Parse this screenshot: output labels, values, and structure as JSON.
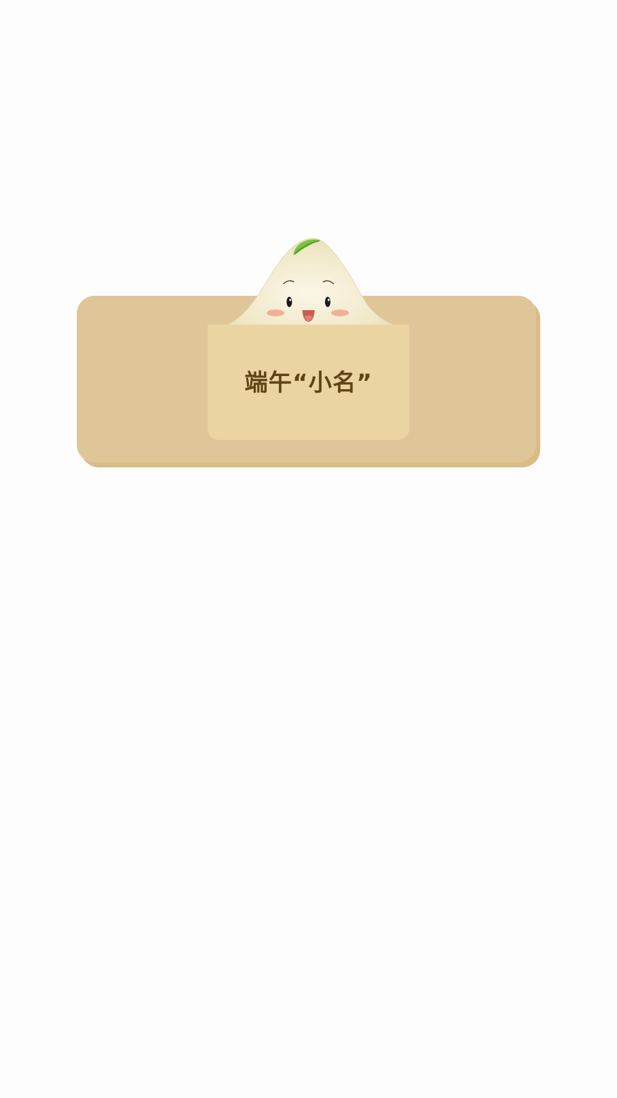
{
  "card": {
    "title": "端午“小名”"
  },
  "mascot": {
    "icon": "zongzi-mascot-icon"
  },
  "colors": {
    "page_background": "#fdfdfd",
    "banner": "#dfc698",
    "banner_shadow": "#d9bc86",
    "panel": "#ead5a2",
    "title_text": "#5e4417",
    "zongzi_body": "#f3ebcf",
    "leaf": "#6cbf3a"
  }
}
